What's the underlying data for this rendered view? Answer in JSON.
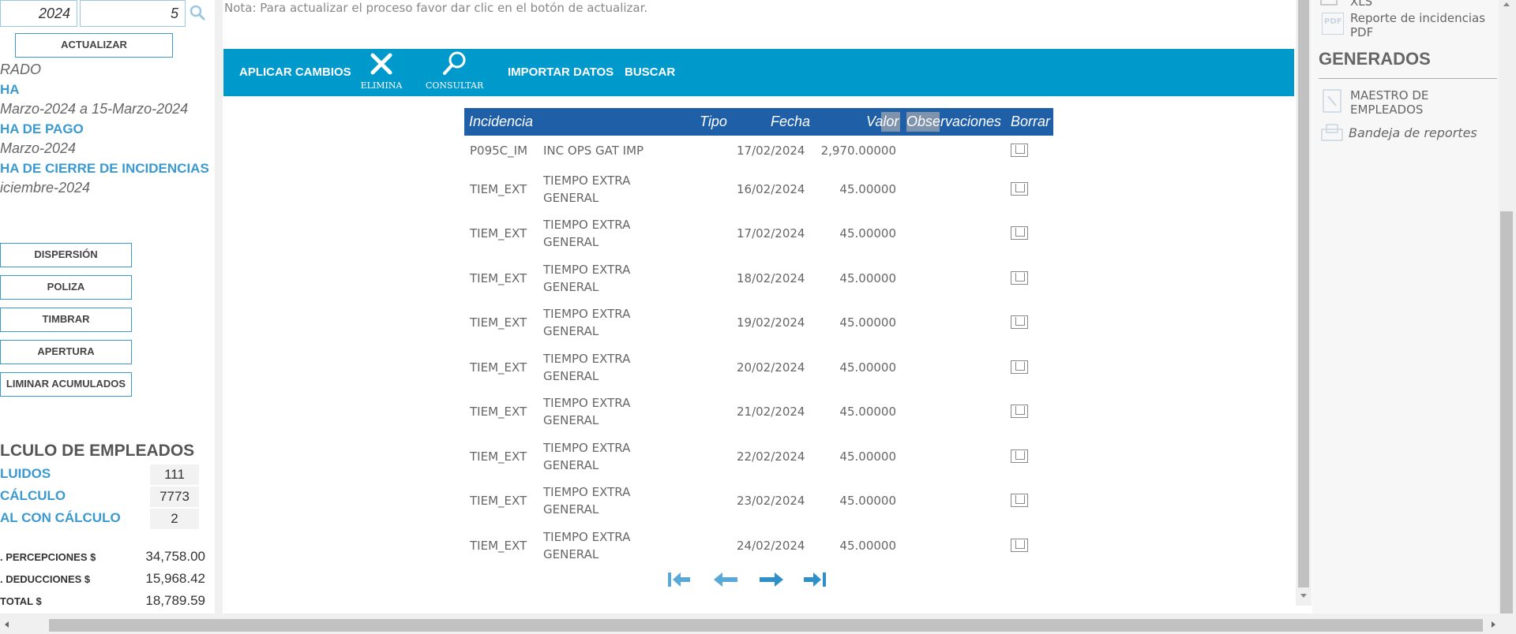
{
  "left_panel": {
    "year": "2024",
    "period": "5",
    "update_button": "ACTUALIZAR",
    "status_value": "RADO",
    "fecha_label": "HA",
    "fecha_value": "Marzo-2024 a 15-Marzo-2024",
    "fecha_pago_label": "HA DE PAGO",
    "fecha_pago_value": "Marzo-2024",
    "fecha_cierre_label": "HA DE CIERRE DE INCIDENCIAS",
    "fecha_cierre_value": "iciembre-2024",
    "actions": [
      "DISPERSIÓN",
      "POLIZA",
      "TIMBRAR",
      "APERTURA",
      "LIMINAR ACUMULADOS"
    ],
    "calc_title": "LCULO DE EMPLEADOS",
    "stats": [
      {
        "label": "LUIDOS",
        "value": "111"
      },
      {
        "label": "CÁLCULO",
        "value": "7773"
      },
      {
        "label": "AL CON CÁLCULO",
        "value": "2"
      }
    ],
    "totals": [
      {
        "label": ". PERCEPCIONES $",
        "value": "34,758.00"
      },
      {
        "label": ". DEDUCCIONES $",
        "value": "15,968.42"
      },
      {
        "label": "TOTAL $",
        "value": "18,789.59"
      }
    ]
  },
  "note": "Nota: Para actualizar el proceso favor dar clic en el botón de actualizar.",
  "toolbar": {
    "apply": "APLICAR CAMBIOS",
    "delete": "ELIMINA",
    "consult": "CONSULTAR",
    "import": "IMPORTAR DATOS",
    "search": "BUSCAR"
  },
  "grid": {
    "headers": {
      "incidencia": "Incidencia",
      "tipo": "Tipo",
      "fecha": "Fecha",
      "valor": "Valor",
      "observaciones": "Observaciones",
      "borrar": "Borrar"
    },
    "rows": [
      {
        "code": "P095C_IM",
        "desc1": "INC OPS GAT IMP",
        "desc2": "",
        "date": "17/02/2024",
        "value": "2,970.00000"
      },
      {
        "code": "TIEM_EXT",
        "desc1": "TIEMPO EXTRA",
        "desc2": "GENERAL",
        "date": "16/02/2024",
        "value": "45.00000"
      },
      {
        "code": "TIEM_EXT",
        "desc1": "TIEMPO EXTRA",
        "desc2": "GENERAL",
        "date": "17/02/2024",
        "value": "45.00000"
      },
      {
        "code": "TIEM_EXT",
        "desc1": "TIEMPO EXTRA",
        "desc2": "GENERAL",
        "date": "18/02/2024",
        "value": "45.00000"
      },
      {
        "code": "TIEM_EXT",
        "desc1": "TIEMPO EXTRA",
        "desc2": "GENERAL",
        "date": "19/02/2024",
        "value": "45.00000"
      },
      {
        "code": "TIEM_EXT",
        "desc1": "TIEMPO EXTRA",
        "desc2": "GENERAL",
        "date": "20/02/2024",
        "value": "45.00000"
      },
      {
        "code": "TIEM_EXT",
        "desc1": "TIEMPO EXTRA",
        "desc2": "GENERAL",
        "date": "21/02/2024",
        "value": "45.00000"
      },
      {
        "code": "TIEM_EXT",
        "desc1": "TIEMPO EXTRA",
        "desc2": "GENERAL",
        "date": "22/02/2024",
        "value": "45.00000"
      },
      {
        "code": "TIEM_EXT",
        "desc1": "TIEMPO EXTRA",
        "desc2": "GENERAL",
        "date": "23/02/2024",
        "value": "45.00000"
      },
      {
        "code": "TIEM_EXT",
        "desc1": "TIEMPO EXTRA",
        "desc2": "GENERAL",
        "date": "24/02/2024",
        "value": "45.00000"
      }
    ]
  },
  "right_panel": {
    "xls_label": "XLS",
    "report_pdf": "Reporte de incidencias PDF",
    "report_pdf_line1": "Reporte de incidencias",
    "report_pdf_line2": "PDF",
    "generated_title": "GENERADOS",
    "maestro_line1": "MAESTRO DE",
    "maestro_line2": "EMPLEADOS",
    "bandeja": "Bandeja de reportes",
    "pdf_icon_text": "PDF"
  },
  "colors": {
    "accent": "#0099cc",
    "grid_header": "#1f5fa8",
    "link_blue": "#3a9ad0"
  },
  "icons": [
    "search-icon",
    "close-x-icon",
    "magnifier-icon",
    "first-page-icon",
    "prev-page-icon",
    "next-page-icon",
    "last-page-icon",
    "pdf-icon",
    "xls-icon",
    "tray-icon"
  ]
}
